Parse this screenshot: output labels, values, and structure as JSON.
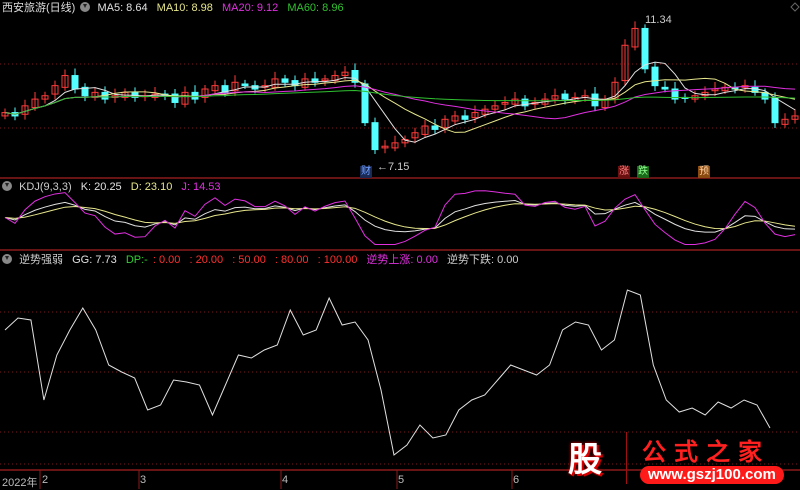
{
  "main_panel": {
    "title": "西安旅游(日线)",
    "ma": [
      {
        "label": "MA5: 8.64",
        "color": "#e0e0e0"
      },
      {
        "label": "MA10: 8.98",
        "color": "#e6e68c"
      },
      {
        "label": "MA20: 9.12",
        "color": "#e030e0"
      },
      {
        "label": "MA60: 8.96",
        "color": "#30c030"
      }
    ],
    "high_marker": "11.34",
    "low_marker": "←7.15",
    "event_tags": [
      {
        "label": "财",
        "color": "#6fa0ff",
        "bg": "#1a2a55"
      },
      {
        "label": "涨",
        "color": "#ff8080",
        "bg": "#6a1010"
      },
      {
        "label": "跌",
        "color": "#90ff90",
        "bg": "#1a6a1a"
      },
      {
        "label": "预",
        "color": "#ffd0a0",
        "bg": "#8a4a10"
      }
    ]
  },
  "kdj_panel": {
    "title": "KDJ(9,3,3)",
    "k": "K: 20.25",
    "d": "D: 23.10",
    "j": "J: 14.53"
  },
  "indicator_panel": {
    "title": "逆势强弱",
    "gg": "GG: 7.73",
    "dp": "DP:-",
    "levels": [
      ": 0.00",
      ": 20.00",
      ": 50.00",
      ": 80.00",
      ": 100.00"
    ],
    "up_label": "逆势上涨: 0.00",
    "down_label": "逆势下跌: 0.00"
  },
  "time_axis": [
    "2022年",
    "2",
    "3",
    "4",
    "5",
    "6"
  ],
  "logo": {
    "char": "股",
    "title": "公式之家",
    "url": "www.gszj100.com"
  },
  "colors": {
    "up": "#ff3c3c",
    "down": "#54ffff",
    "grid": "#8b1a1a"
  },
  "chart_data": {
    "type": "candlestick",
    "close": [
      8.5,
      8.4,
      8.7,
      8.9,
      9.0,
      9.3,
      9.6,
      9.2,
      9.0,
      9.1,
      8.9,
      9.0,
      9.1,
      8.95,
      9.0,
      9.05,
      9.0,
      8.8,
      9.1,
      8.9,
      9.2,
      9.3,
      9.1,
      9.4,
      9.3,
      9.2,
      9.3,
      9.5,
      9.4,
      9.3,
      9.5,
      9.4,
      9.5,
      9.6,
      9.7,
      9.4,
      8.2,
      7.4,
      7.5,
      7.6,
      7.7,
      7.9,
      8.1,
      8.0,
      8.3,
      8.4,
      8.3,
      8.5,
      8.6,
      8.7,
      8.8,
      8.9,
      8.7,
      8.8,
      8.9,
      9.0,
      8.9,
      8.95,
      9.0,
      8.7,
      8.9,
      9.4,
      10.5,
      11.0,
      9.8,
      9.3,
      9.2,
      8.9,
      8.95,
      9.0,
      9.1,
      9.2,
      9.25,
      9.2,
      9.3,
      9.1,
      8.9,
      8.2,
      8.3,
      8.4
    ],
    "price_range": [
      7.0,
      11.5
    ],
    "gg_series": [
      71,
      77,
      76,
      36,
      58.5,
      71,
      82,
      71,
      53.5,
      50,
      47,
      31,
      33.5,
      46,
      45,
      43.5,
      28.5,
      43.5,
      58.5,
      57,
      61,
      63.5,
      81,
      68.5,
      71,
      87,
      73.5,
      75,
      66,
      41,
      8.5,
      13.5,
      23.5,
      17,
      18.5,
      31,
      36,
      38.5,
      46,
      53.5,
      51,
      48.5,
      53.5,
      71,
      75,
      73.5,
      61,
      66,
      91,
      88.5,
      53.5,
      36,
      30,
      32,
      28.5,
      35,
      32,
      36,
      33.5,
      22
    ],
    "gg_range": [
      0,
      100
    ]
  }
}
